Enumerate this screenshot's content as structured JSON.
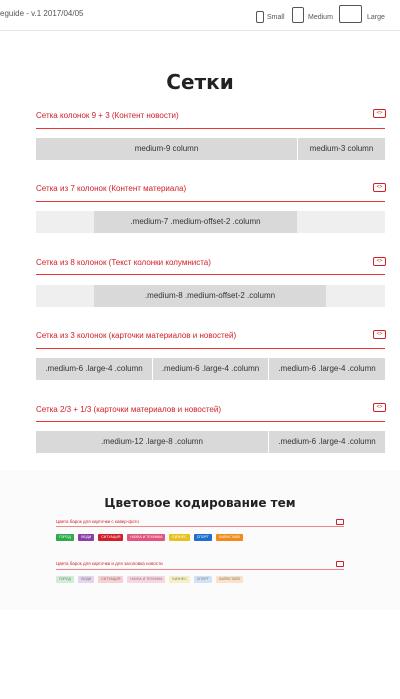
{
  "topbar": {
    "version": "eguide - v.1 2017/04/05",
    "devices": [
      {
        "label": "Small",
        "icon": "phone-icon"
      },
      {
        "label": "Medium",
        "icon": "tablet-icon"
      },
      {
        "label": "Large",
        "icon": "desktop-icon"
      }
    ]
  },
  "page_title": "Сетки",
  "code_icon_glyph": "<>",
  "sections": [
    {
      "title": "Сетка колонок 9 + 3 (Контент новости)",
      "cells": [
        "medium-9 column",
        "medium-3 column"
      ]
    },
    {
      "title": "Сетка из 7 колонок (Контент материала)",
      "cells": [
        ".medium-7 .medium-offset-2 .column"
      ]
    },
    {
      "title": "Сетка из 8 колонок (Текст колонки колумниста)",
      "cells": [
        ".medium-8 .medium-offset-2 .column"
      ]
    },
    {
      "title": "Сетка из 3 колонок (карточки материалов и новостей)",
      "cells": [
        ".medium-6 .large-4 .column",
        ".medium-6 .large-4 .column",
        ".medium-6 .large-4 .column"
      ]
    },
    {
      "title": "Сетка 2/3 + 1/3 (карточки материалов и новостей)",
      "cells": [
        ".medium-12 .large-8 .column",
        ".medium-6 .large-4 .column"
      ]
    }
  ],
  "color_coding": {
    "title": "Цветовое кодирование тем",
    "groups": [
      {
        "title": "Цвета барок для карточки с кавер-фото",
        "tags": [
          {
            "label": "ГОРОД",
            "color": "#2eaa4a"
          },
          {
            "label": "ЛЮДИ",
            "color": "#8b3fa5"
          },
          {
            "label": "СИТУАЦИЯ",
            "color": "#d0202a"
          },
          {
            "label": "НАУКА И ТЕХНИКА",
            "color": "#e0567f"
          },
          {
            "label": "БИЗНЕС",
            "color": "#e5c21e"
          },
          {
            "label": "СПОРТ",
            "color": "#1f6fd0"
          },
          {
            "label": "ЛАЙФСТАЙЛ",
            "color": "#f08a1a"
          }
        ]
      },
      {
        "title": "Цвета барок для карточки и для заголовка новости",
        "tags": [
          {
            "label": "ГОРОД",
            "color": "#cfeed6"
          },
          {
            "label": "ЛЮДИ",
            "color": "#e6d4ee"
          },
          {
            "label": "СИТУАЦИЯ",
            "color": "#f6d0d2"
          },
          {
            "label": "НАУКА И ТЕХНИКА",
            "color": "#f7d6e0"
          },
          {
            "label": "БИЗНЕС",
            "color": "#f8efc4"
          },
          {
            "label": "СПОРТ",
            "color": "#d2e2f6"
          },
          {
            "label": "ЛАЙФСТАЙЛ",
            "color": "#fbe1c6"
          }
        ]
      }
    ]
  }
}
